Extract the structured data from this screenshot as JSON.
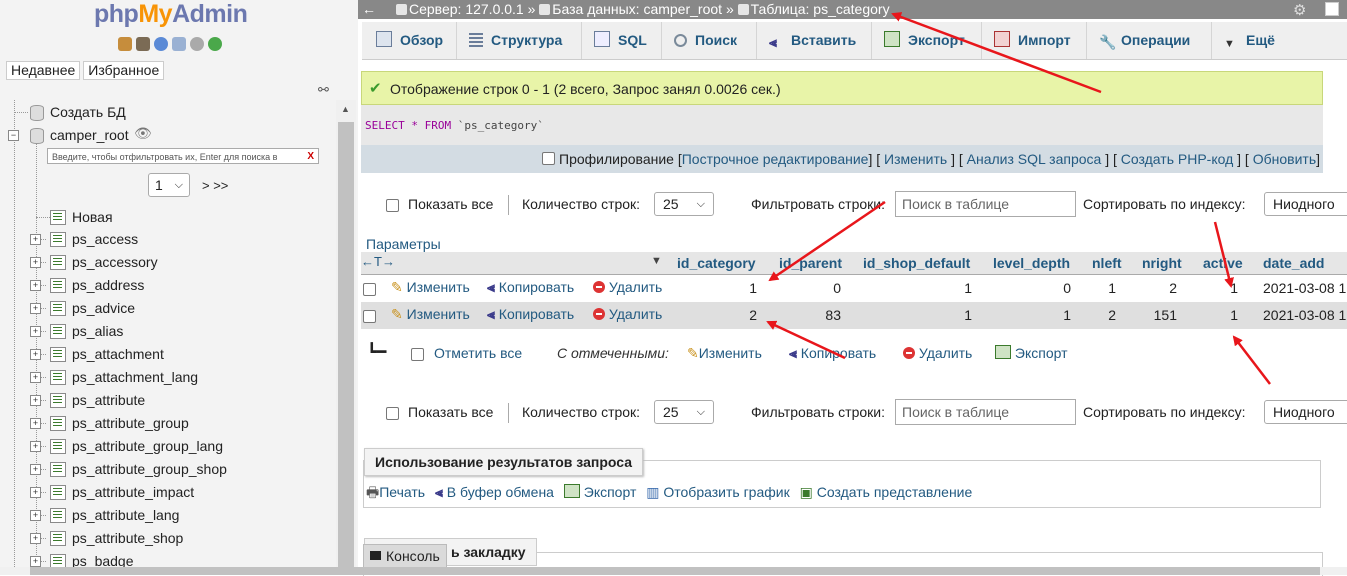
{
  "nav": {
    "logo": {
      "php": "php",
      "my": "My",
      "admin": "Admin"
    },
    "tabs": [
      "Недавнее",
      "Избранное"
    ],
    "create_db": "Создать БД",
    "db_name": "camper_root",
    "filter_placeholder": "Введите, чтобы отфильтровать их, Enter для поиска в",
    "filter_clear": "X",
    "page_value": "1",
    "page_next": "> >>",
    "new_label": "Новая",
    "tables": [
      "ps_access",
      "ps_accessory",
      "ps_address",
      "ps_advice",
      "ps_alias",
      "ps_attachment",
      "ps_attachment_lang",
      "ps_attribute",
      "ps_attribute_group",
      "ps_attribute_group_lang",
      "ps_attribute_group_shop",
      "ps_attribute_impact",
      "ps_attribute_lang",
      "ps_attribute_shop",
      "ps_badge"
    ]
  },
  "topbar": {
    "back": "←",
    "server": "Сервер: 127.0.0.1",
    "sep": "»",
    "database": "База данных: camper_root",
    "table": "Таблица: ps_category"
  },
  "menu": {
    "tabs": [
      "Обзор",
      "Структура",
      "SQL",
      "Поиск",
      "Вставить",
      "Экспорт",
      "Импорт",
      "Операции",
      "Ещё"
    ]
  },
  "result": {
    "success": "Отображение строк 0 - 1 (2 всего, Запрос занял 0.0026 сек.)",
    "sql_select": "SELECT",
    "sql_star": "*",
    "sql_from": "FROM",
    "sql_table": "`ps_category`",
    "profiling": "Профилирование",
    "links": [
      "Построчное редактирование",
      "Изменить",
      "Анализ SQL запроса",
      "Создать PHP-код",
      "Обновить"
    ]
  },
  "navbar": {
    "show_all": "Показать все",
    "rows_label": "Количество строк:",
    "rows_value": "25",
    "filter_label": "Фильтровать строки:",
    "filter_placeholder": "Поиск в таблице",
    "sort_label": "Сортировать по индексу:",
    "sort_value": "Ниодного"
  },
  "grid": {
    "params": "Параметры",
    "columns": [
      "id_category",
      "id_parent",
      "id_shop_default",
      "level_depth",
      "nleft",
      "nright",
      "active",
      "date_add"
    ],
    "actions": {
      "edit": "Изменить",
      "copy": "Копировать",
      "delete": "Удалить"
    },
    "rows": [
      {
        "id_category": "1",
        "id_parent": "0",
        "id_shop_default": "1",
        "level_depth": "0",
        "nleft": "1",
        "nright": "2",
        "active": "1",
        "date_add": "2021-03-08 1"
      },
      {
        "id_category": "2",
        "id_parent": "83",
        "id_shop_default": "1",
        "level_depth": "1",
        "nleft": "2",
        "nright": "151",
        "active": "1",
        "date_add": "2021-03-08 1"
      }
    ]
  },
  "with_selected": {
    "check_all": "Отметить все",
    "label": "С отмеченными:",
    "edit": "Изменить",
    "copy": "Копировать",
    "delete": "Удалить",
    "export": "Экспорт"
  },
  "query_results": {
    "title": "Использование результатов запроса",
    "ops": [
      "Печать",
      "В буфер обмена",
      "Экспорт",
      "Отобразить график",
      "Создать представление"
    ]
  },
  "bookmark": {
    "title": "ь закладку"
  },
  "console": {
    "label": "Консоль"
  },
  "colors": {
    "link": "#235a81",
    "success_bg": "#e8f4a8",
    "topbar": "#888888",
    "arrow": "#e8161b"
  }
}
